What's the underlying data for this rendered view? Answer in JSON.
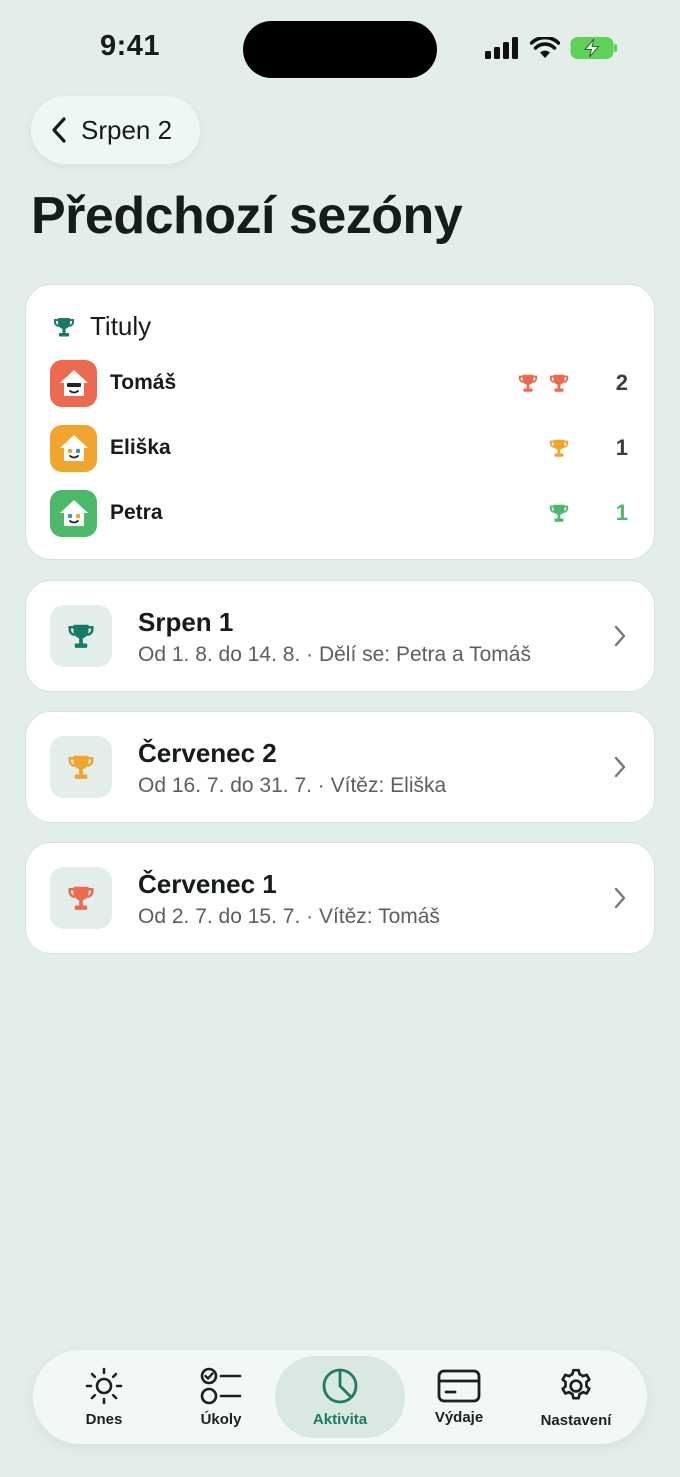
{
  "status_bar": {
    "time": "9:41"
  },
  "nav": {
    "back_label": "Srpen 2"
  },
  "page_title": "Předchozí sezóny",
  "titles": {
    "heading": "Tituly",
    "players": [
      {
        "name": "Tomáš",
        "count": "2",
        "cups": 2,
        "color": "#ec6a50"
      },
      {
        "name": "Eliška",
        "count": "1",
        "cups": 1,
        "color": "#f0a52f"
      },
      {
        "name": "Petra",
        "count": "1",
        "cups": 1,
        "color": "#4cb86a"
      }
    ]
  },
  "seasons": [
    {
      "title": "Srpen 1",
      "subtitle": "Od 1. 8. do 14. 8. · Dělí se: Petra a Tomáš",
      "color": "#177a6a"
    },
    {
      "title": "Červenec 2",
      "subtitle": "Od 16. 7. do 31. 7. · Vítěz: Eliška",
      "color": "#f0a52f"
    },
    {
      "title": "Červenec 1",
      "subtitle": "Od 2. 7. do 15. 7. · Vítěz: Tomáš",
      "color": "#ec6a50"
    }
  ],
  "tabs": [
    {
      "label": "Dnes",
      "icon": "sun-icon"
    },
    {
      "label": "Úkoly",
      "icon": "checklist-icon"
    },
    {
      "label": "Aktivita",
      "icon": "pie-chart-icon",
      "active": true
    },
    {
      "label": "Výdaje",
      "icon": "card-icon"
    },
    {
      "label": "Nastavení",
      "icon": "gear-icon"
    }
  ],
  "colors": {
    "accent": "#1c7a66",
    "background": "#e3eee8"
  }
}
